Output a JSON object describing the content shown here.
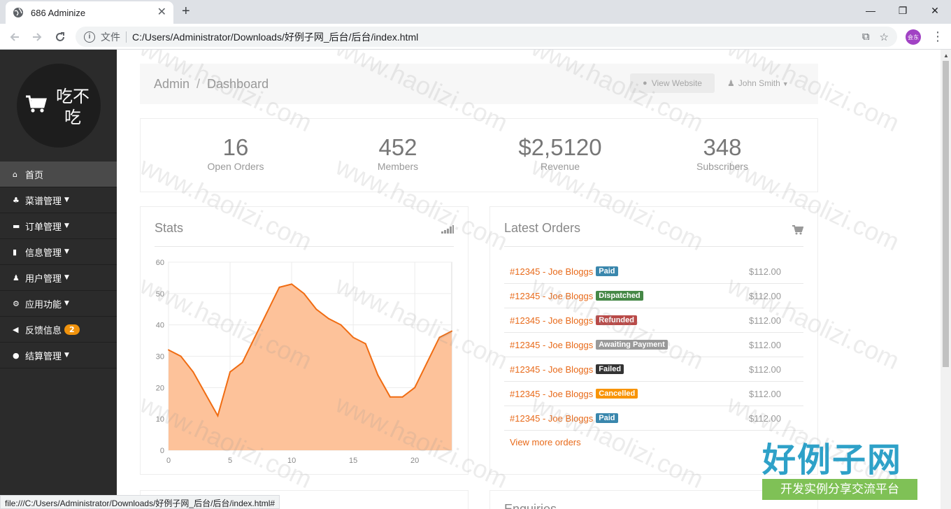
{
  "browser": {
    "tab_title": "686 Adminize",
    "scheme_label": "文件",
    "url": "C:/Users/Administrator/Downloads/好例子网_后台/后台/index.html",
    "avatar_text": "会东",
    "status_url": "file:///C:/Users/Administrator/Downloads/好例子网_后台/后台/index.html#"
  },
  "sidebar": {
    "logo_text": "吃不吃",
    "items": [
      {
        "icon": "home-icon",
        "label": "首页",
        "caret": false
      },
      {
        "icon": "sitemap-icon",
        "label": "菜谱管理",
        "caret": true
      },
      {
        "icon": "cart-icon",
        "label": "订单管理",
        "caret": true
      },
      {
        "icon": "signal-icon",
        "label": "信息管理",
        "caret": true
      },
      {
        "icon": "users-icon",
        "label": "用户管理",
        "caret": true
      },
      {
        "icon": "cogs-icon",
        "label": "应用功能",
        "caret": true
      },
      {
        "icon": "bullhorn-icon",
        "label": "反馈信息",
        "caret": false,
        "badge": "2"
      },
      {
        "icon": "info-icon",
        "label": "结算管理",
        "caret": true
      }
    ]
  },
  "header": {
    "crumb_root": "Admin",
    "crumb_page": "Dashboard",
    "view_website": "View Website",
    "user_name": "John Smith"
  },
  "stats": [
    {
      "value": "16",
      "label": "Open Orders"
    },
    {
      "value": "452",
      "label": "Members"
    },
    {
      "value": "$2,5120",
      "label": "Revenue"
    },
    {
      "value": "348",
      "label": "Subscribers"
    }
  ],
  "stats_panel": {
    "title": "Stats"
  },
  "orders_panel": {
    "title": "Latest Orders",
    "rows": [
      {
        "order": "#12345 - Joe Bloggs",
        "status": "Paid",
        "color": "#3a87ad",
        "amount": "$112.00"
      },
      {
        "order": "#12345 - Joe Bloggs",
        "status": "Dispatched",
        "color": "#468847",
        "amount": "$112.00"
      },
      {
        "order": "#12345 - Joe Bloggs",
        "status": "Refunded",
        "color": "#b94a48",
        "amount": "$112.00"
      },
      {
        "order": "#12345 - Joe Bloggs",
        "status": "Awaiting Payment",
        "color": "#999999",
        "amount": "$112.00"
      },
      {
        "order": "#12345 - Joe Bloggs",
        "status": "Failed",
        "color": "#333333",
        "amount": "$112.00"
      },
      {
        "order": "#12345 - Joe Bloggs",
        "status": "Cancelled",
        "color": "#f89406",
        "amount": "$112.00"
      },
      {
        "order": "#12345 - Joe Bloggs",
        "status": "Paid",
        "color": "#3a87ad",
        "amount": "$112.00"
      }
    ],
    "more_link": "View more orders"
  },
  "enquiries_panel": {
    "title": "Enquiries"
  },
  "watermark": {
    "text": "www.haolizi.com",
    "brand_big": "好例子网",
    "brand_small": "开发实例分享交流平台"
  },
  "colors": {
    "accent": "#e86a1a",
    "chart_fill": "#fdc29a",
    "chart_line": "#f06c12"
  },
  "chart_data": {
    "type": "area",
    "title": "Stats",
    "xlabel": "",
    "ylabel": "",
    "x": [
      0,
      1,
      2,
      3,
      4,
      5,
      6,
      7,
      8,
      9,
      10,
      11,
      12,
      13,
      14,
      15,
      16,
      17,
      18,
      19,
      20,
      21,
      22,
      23
    ],
    "values": [
      32,
      30,
      25,
      18,
      11,
      25,
      28,
      36,
      44,
      52,
      53,
      50,
      45,
      42,
      40,
      36,
      34,
      24,
      17,
      17,
      20,
      28,
      36,
      38
    ],
    "xlim": [
      0,
      23
    ],
    "ylim": [
      0,
      60
    ],
    "xticks": [
      0,
      5,
      10,
      15,
      20
    ],
    "yticks": [
      0,
      10,
      20,
      30,
      40,
      50,
      60
    ],
    "grid": true
  }
}
